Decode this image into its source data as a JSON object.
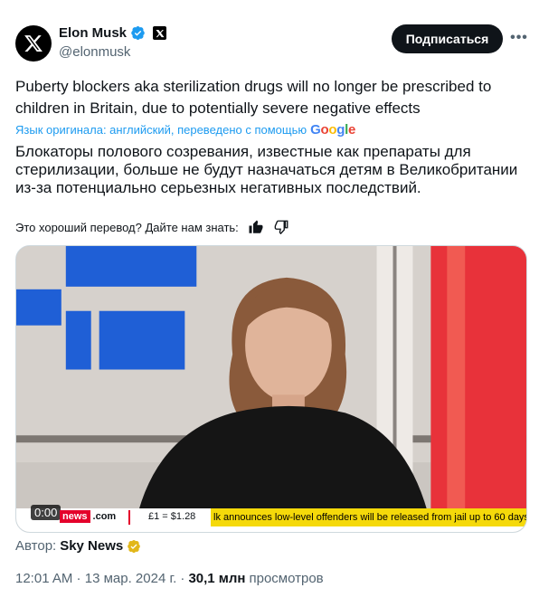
{
  "author": {
    "display_name": "Elon Musk",
    "handle": "@elonmusk",
    "subscribe_label": "Подписаться",
    "more_label": "•••"
  },
  "tweet": {
    "original_text": "Puberty blockers aka sterilization drugs will no longer be prescribed to children in Britain, due to potentially severe negative effects",
    "translation_note": "Язык оригинала: английский, переведено с помощью",
    "google_label": "Google",
    "translated_text": "Блокаторы полового созревания, известные как препараты для стерилизации, больше не будут назначаться детям в Великобритании из-за потенциально серьезных негативных последствий.",
    "feedback_label": "Это хороший перевод? Дайте нам знать:"
  },
  "media": {
    "time_badge": "0:00",
    "sky_label": "news",
    "com_label": ".com",
    "fx_label": "£1 = $1.28",
    "ticker_text": "lk announces low-level offenders will be released from jail up to 60 days"
  },
  "attribution": {
    "prefix": "Автор:",
    "source": "Sky News"
  },
  "meta": {
    "time": "12:01 AM",
    "date": "13 мар. 2024 г.",
    "views": "30,1 млн",
    "views_label": "просмотров"
  },
  "colors": {
    "accent": "#1d9bf0",
    "text": "#0f1419",
    "muted": "#536471",
    "gold": "#e2b719"
  }
}
